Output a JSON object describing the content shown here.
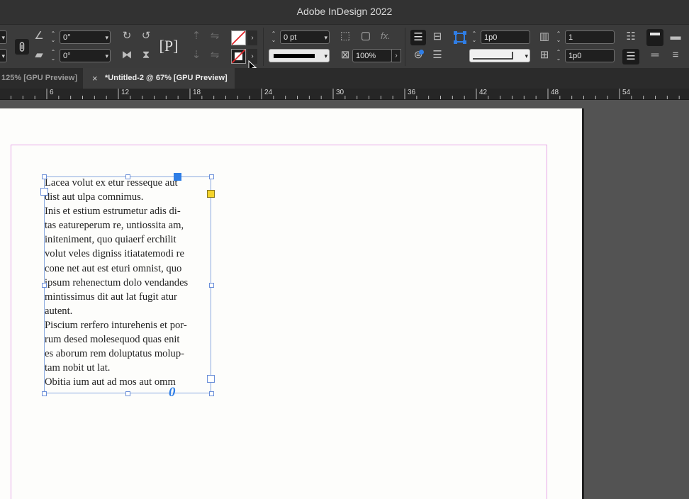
{
  "app": {
    "title": "Adobe InDesign 2022"
  },
  "toolbar": {
    "rotation_angle": "0°",
    "shear_angle": "0°",
    "stroke_weight": "0 pt",
    "opacity": "100%",
    "gutter_value": "1p0",
    "columns_value": "1",
    "baseline_offset": "1p0",
    "column_width": "1p0"
  },
  "tabs": [
    {
      "label": "125% [GPU Preview]",
      "active": false
    },
    {
      "label": "*Untitled-2 @ 67% [GPU Preview]",
      "active": true
    }
  ],
  "ruler": {
    "labels": [
      "6",
      "12",
      "18",
      "24",
      "30",
      "36",
      "42",
      "48",
      "54"
    ]
  },
  "document": {
    "story_lines": [
      "Lacea volut ex etur resseque aut",
      "dist aut ulpa comnimus.",
      "Inis et estium estrumetur adis di-",
      "tas eatureperum re, untiossita am,",
      "initeniment, quo quiaerf erchilit",
      "volut veles digniss itiatatemodi re",
      "cone net aut est eturi omnist, quo",
      "ipsum rehenectum dolo vendandes",
      "mintissimus dit aut lat fugit atur",
      "autent.",
      "Piscium rerfero inturehenis et por-",
      "rum desed molesequod quas enit",
      "es aborum rem doluptatus molup-",
      "tam nobit ut lat.",
      "Obitia ium aut ad mos aut omm"
    ],
    "overset_indicator": "0"
  },
  "colors": {
    "accent": "#2f7ee6",
    "content_grabber": "#f5d42a",
    "margin_guide": "#e7a7e7",
    "frame_edge": "#8aa9e0"
  }
}
